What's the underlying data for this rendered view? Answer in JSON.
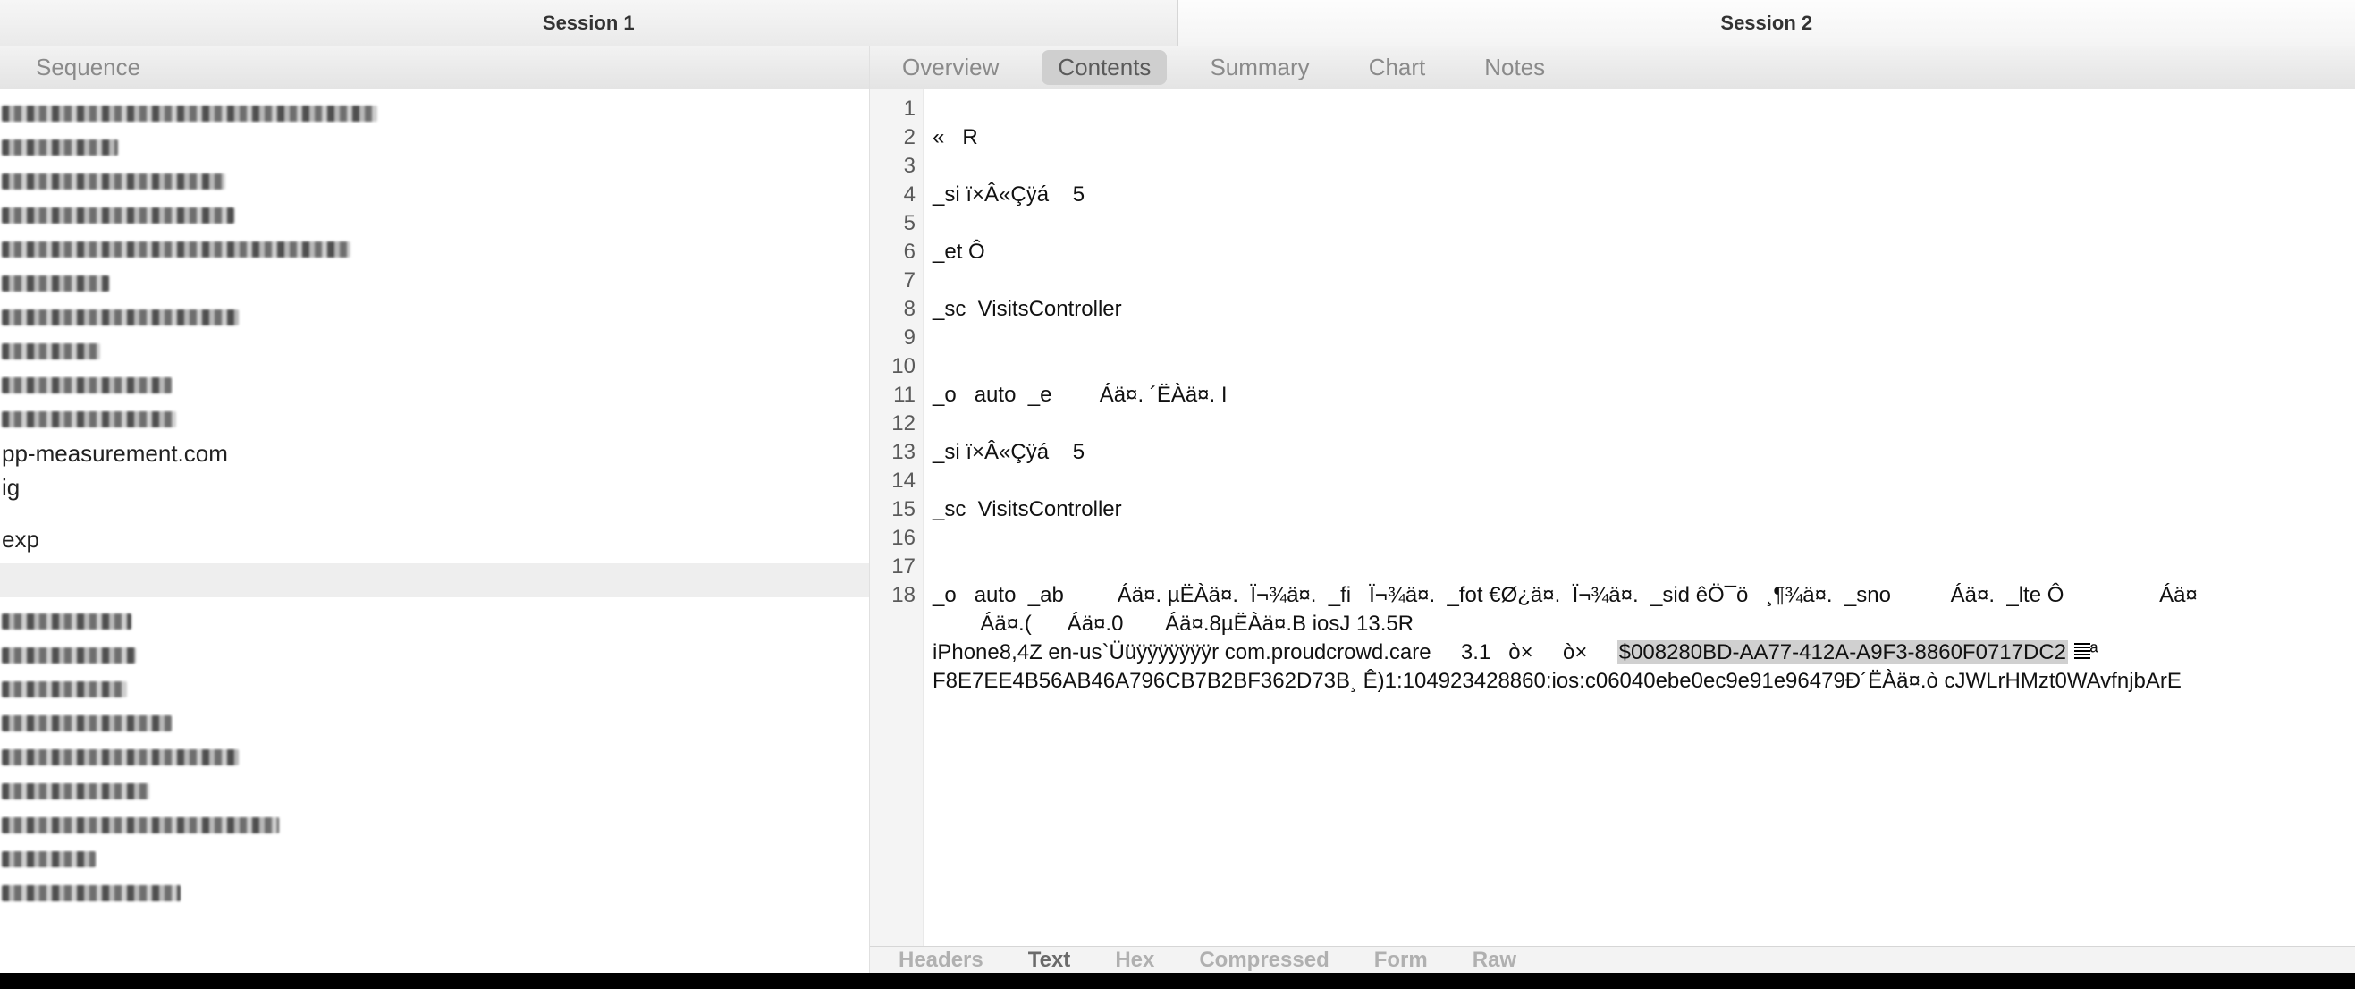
{
  "sessions": {
    "tab1": "Session 1",
    "tab2": "Session 2"
  },
  "left_toolbar": {
    "sequence": "Sequence"
  },
  "right_toolbar": {
    "overview": "Overview",
    "contents": "Contents",
    "summary": "Summary",
    "chart": "Chart",
    "notes": "Notes"
  },
  "left_list": {
    "clear1": "pp-measurement.com",
    "clear2": "ig",
    "clear3": "exp"
  },
  "viewer": {
    "line_numbers": "1\n2\n3\n4\n5\n6\n7\n8\n9\n10\n11\n12\n13\n14\n15\n16\n17\n18",
    "l2": "«   R",
    "l4": "_si ï×Â«Çÿá    5",
    "l6": "_et Ô",
    "l8": "_sc  VisitsController",
    "l11": "_o   auto  _e        Áä¤. ´ËÀä¤. I",
    "l13": "_si ï×Â«Çÿá    5",
    "l15": "_sc  VisitsController",
    "l18a": "_o   auto  _ab         Áä¤. µËÀä¤.  Ï¬¾ä¤.  _fi   Ï¬¾ä¤.  _fot €Ø¿ä¤.  Ï¬¾ä¤.  _sid êÖ¯ö   ¸¶¾ä¤.  _sno          Áä¤.  _lte Ô                Áä¤",
    "l18b": "        Áä¤.(      Áä¤.0       Áä¤.8µËÀä¤.B iosJ 13.5R",
    "l18c_pre": "iPhone8,4Z en-us`Üüÿÿÿÿÿÿÿr com.proudcrowd.care     3.1   ò×     ò×     ",
    "l18c_hi": "$008280BD-AA77-412A-A9F3-8860F0717DC2",
    "l18c_post": "ª",
    "l18d": "F8E7EE4B56AB46A796CB7B2BF362D73B¸ Ê)1:104923428860:ios:c06040ebe0ec9e91e96479Ð´ËÀä¤.ò cJWLrHMzt0WAvfnjbArE"
  },
  "bottom_tabs": {
    "headers": "Headers",
    "text": "Text",
    "hex": "Hex",
    "compressed": "Compressed",
    "form": "Form",
    "raw": "Raw"
  }
}
